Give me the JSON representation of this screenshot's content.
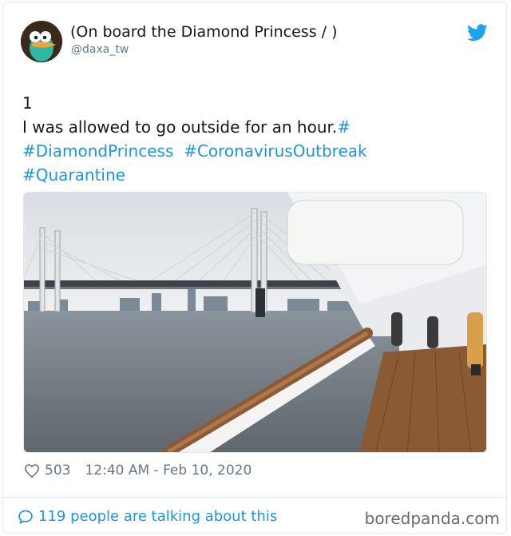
{
  "author": {
    "display_name": "(On board the Diamond Princess / )",
    "handle": "@daxa_tw"
  },
  "tweet": {
    "line1": "1",
    "line2_text": "I was allowed to go outside for an hour.",
    "line2_hash": "#",
    "hashtags_row1a": "#DiamondPrincess",
    "hashtags_row1b": "#CoronavirusOutbreak",
    "hashtags_row2": "#Quarantine"
  },
  "photo": {
    "description_icon": "photo"
  },
  "meta": {
    "likes": "503",
    "timestamp": "12:40 AM - Feb 10, 2020"
  },
  "footer": {
    "talking": "119 people are talking about this",
    "brand": "boredpanda.com"
  },
  "colors": {
    "link": "#1b95e0",
    "muted": "#657786",
    "border": "#e1e8ed"
  }
}
